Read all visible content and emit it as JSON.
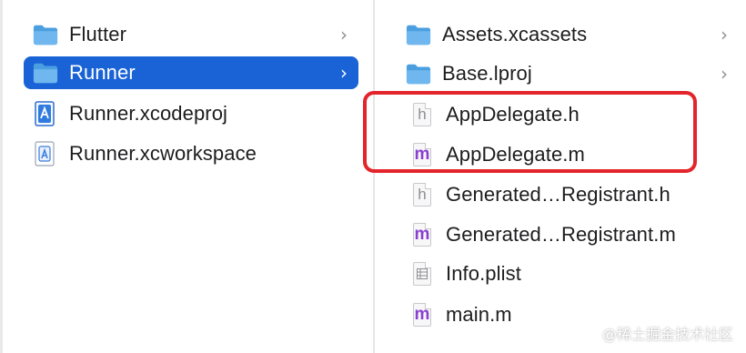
{
  "left_column": {
    "items": [
      {
        "label": "Flutter",
        "icon": "folder-icon",
        "has_children": true,
        "selected": false
      },
      {
        "label": "Runner",
        "icon": "folder-icon",
        "has_children": true,
        "selected": true
      },
      {
        "label": "Runner.xcodeproj",
        "icon": "xcodeproj-icon",
        "has_children": false,
        "selected": false
      },
      {
        "label": "Runner.xcworkspace",
        "icon": "xcworkspace-icon",
        "has_children": false,
        "selected": false
      }
    ]
  },
  "right_column": {
    "items": [
      {
        "label": "Assets.xcassets",
        "icon": "folder-icon",
        "has_children": true
      },
      {
        "label": "Base.lproj",
        "icon": "folder-icon",
        "has_children": true
      },
      {
        "label": "AppDelegate.h",
        "icon": "header-file-icon",
        "badge": "h"
      },
      {
        "label": "AppDelegate.m",
        "icon": "objc-source-file-icon",
        "badge": "m"
      },
      {
        "label": "Generated…Registrant.h",
        "icon": "header-file-icon",
        "badge": "h"
      },
      {
        "label": "Generated…Registrant.m",
        "icon": "objc-source-file-icon",
        "badge": "m"
      },
      {
        "label": "Info.plist",
        "icon": "plist-file-icon"
      },
      {
        "label": "main.m",
        "icon": "objc-source-file-icon",
        "badge": "m"
      }
    ]
  },
  "chevron": "›",
  "watermark": "@稀土掘金技术社区",
  "colors": {
    "selection": "#1a63d6",
    "highlight": "#e3242b",
    "folder": "#5aa9e6",
    "m_badge": "#8a3fd1",
    "h_badge": "#8e8e93"
  }
}
